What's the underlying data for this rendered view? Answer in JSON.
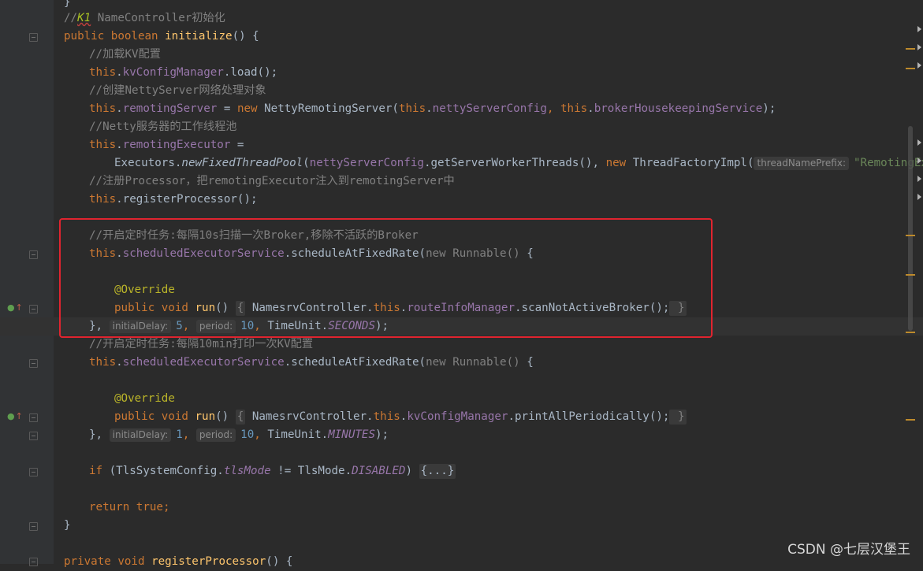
{
  "editor": {
    "lines": {
      "l0": "}",
      "l1_comment_prefix": "//",
      "l1_k1": "K1",
      "l1_comment_rest": " NameController初始化",
      "l2_public": "public ",
      "l2_boolean": "boolean ",
      "l2_name": "initialize",
      "l2_rest": "() {",
      "l3": "//加载KV配置",
      "l4_this": "this",
      "l4_dot": ".",
      "l4_field": "kvConfigManager",
      "l4_rest": ".load();",
      "l5": "//创建NettyServer网络处理对象",
      "l6_this": "this",
      "l6_dot": ".",
      "l6_field": "remotingServer",
      "l6_eq": " = ",
      "l6_new": "new ",
      "l6_cls": "NettyRemotingServer(",
      "l6_this2": "this",
      "l6_dot2": ".",
      "l6_field2": "nettyServerConfig",
      "l6_comma": ", ",
      "l6_this3": "this",
      "l6_dot3": ".",
      "l6_field3": "brokerHousekeepingService",
      "l6_end": ");",
      "l7": "//Netty服务器的工作线程池",
      "l8_this": "this",
      "l8_dot": ".",
      "l8_field": "remotingExecutor",
      "l8_eq": " =",
      "l9_cls": "Executors",
      "l9_dot": ".",
      "l9_method": "newFixedThreadPool",
      "l9_paren": "(",
      "l9_field": "nettyServerConfig",
      "l9_call": ".getServerWorkerThreads(), ",
      "l9_new": "new ",
      "l9_cls2": "ThreadFactoryImpl(",
      "l9_hint": "threadNamePrefix:",
      "l9_str": "\"RemotingExecutt",
      "l10": "//注册Processor，把remotingExecutor注入到remotingServer中",
      "l11_this": "this",
      "l11_rest": ".registerProcessor();",
      "l13": "//开启定时任务:每隔10s扫描一次Broker,移除不活跃的Broker",
      "l14_this": "this",
      "l14_dot": ".",
      "l14_field": "scheduledExecutorService",
      "l14_call": ".scheduleAtFixedRate(",
      "l14_new": "new Runnable() ",
      "l14_brace": "{",
      "l16": "@Override",
      "l17_public": "public ",
      "l17_void": "void ",
      "l17_run": "run",
      "l17_paren": "() ",
      "l17_ob": "{",
      "l17_cls": " NamesrvController.",
      "l17_this": "this",
      "l17_dot": ".",
      "l17_field": "routeInfoManager",
      "l17_call": ".scanNotActiveBroker();",
      "l17_cb": " }",
      "l18_close": "},",
      "l18_hint1": "initialDelay:",
      "l18_num1": "5",
      "l18_comma1": ",",
      "l18_hint2": "period:",
      "l18_num2": "10",
      "l18_comma2": ", ",
      "l18_cls": "TimeUnit.",
      "l18_const": "SECONDS",
      "l18_end": ");",
      "l19": "//开启定时任务:每隔10min打印一次KV配置",
      "l20_this": "this",
      "l20_dot": ".",
      "l20_field": "scheduledExecutorService",
      "l20_call": ".scheduleAtFixedRate(",
      "l20_new": "new Runnable() ",
      "l20_brace": "{",
      "l22": "@Override",
      "l23_public": "public ",
      "l23_void": "void ",
      "l23_run": "run",
      "l23_paren": "() ",
      "l23_ob": "{",
      "l23_cls": " NamesrvController.",
      "l23_this": "this",
      "l23_dot": ".",
      "l23_field": "kvConfigManager",
      "l23_call": ".printAllPeriodically();",
      "l23_cb": " }",
      "l24_close": "},",
      "l24_hint1": "initialDelay:",
      "l24_num1": "1",
      "l24_comma1": ",",
      "l24_hint2": "period:",
      "l24_num2": "10",
      "l24_comma2": ", ",
      "l24_cls": "TimeUnit.",
      "l24_const": "MINUTES",
      "l24_end": ");",
      "l26_if": "if ",
      "l26_open": "(TlsSystemConfig.",
      "l26_field": "tlsMode",
      "l26_ne": " != TlsMode.",
      "l26_const": "DISABLED",
      "l26_close": ") ",
      "l26_fold": "{...}",
      "l28_return": "return ",
      "l28_true": "true",
      "l28_end": ";",
      "l29": "}",
      "l31_private": "private ",
      "l31_void": "void ",
      "l31_name": "registerProcessor",
      "l31_rest": "() {"
    }
  },
  "watermark": "CSDN @七层汉堡王",
  "colors": {
    "background": "#2b2b2b",
    "keyword": "#cc7832",
    "field": "#9876aa",
    "method": "#ffc66d",
    "comment": "#808080",
    "string": "#6a8759",
    "number": "#6897bb",
    "annotation": "#bbb529",
    "highlight_box": "#e0242f"
  },
  "icons": [
    "override-icon",
    "fold-toggle-icon",
    "lightbulb-icon",
    "scroll-arrow-icon"
  ]
}
